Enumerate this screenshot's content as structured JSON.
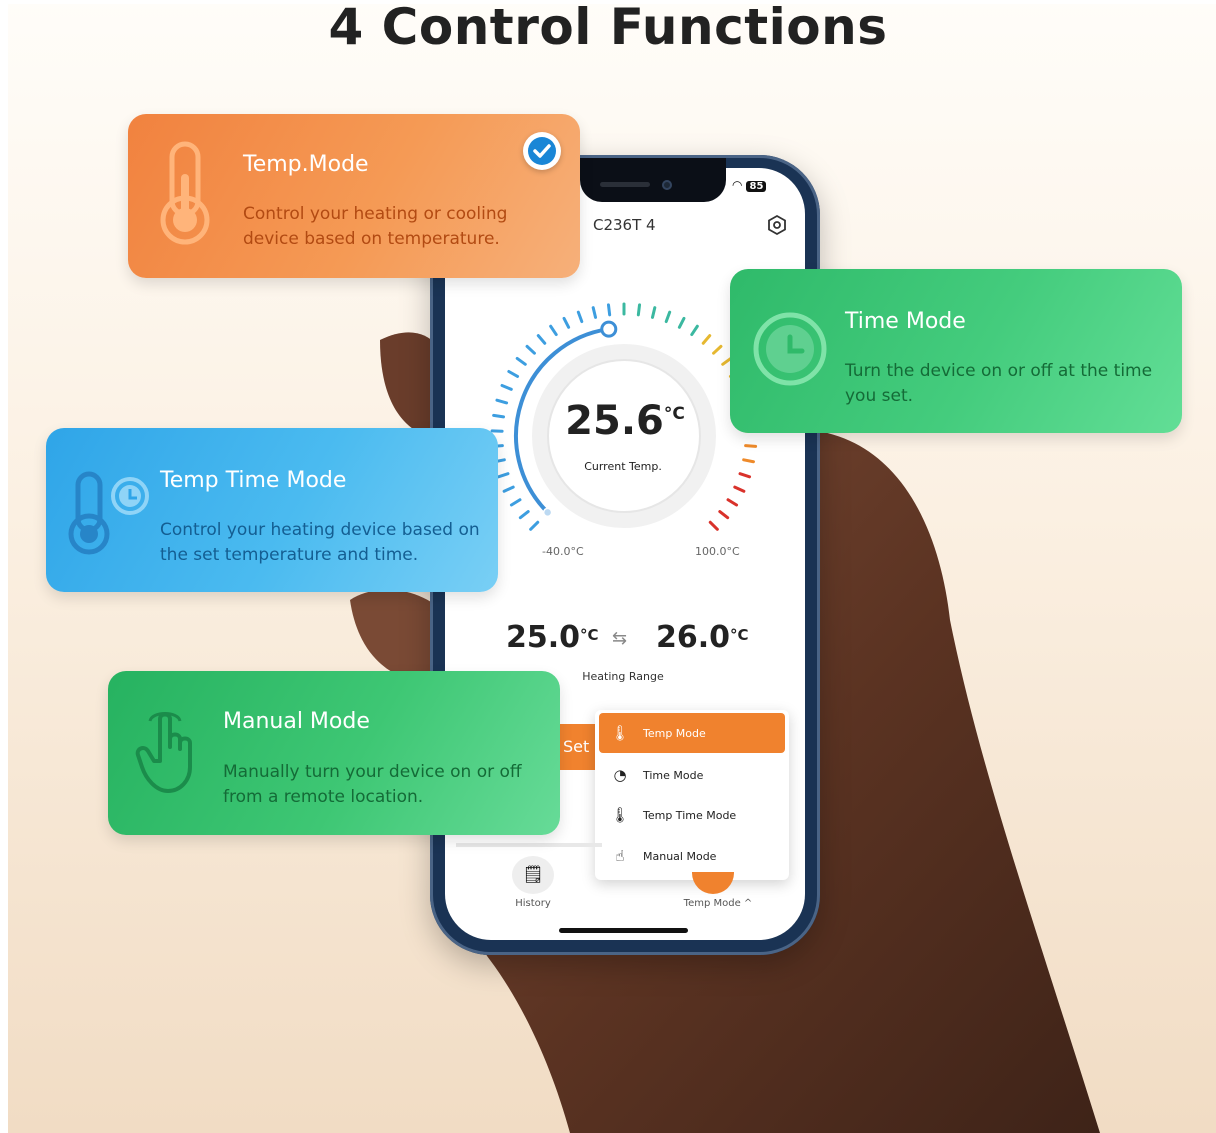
{
  "header": {
    "title": "4 Control Functions"
  },
  "phone": {
    "status_battery": "85",
    "device_name": "C236T 4",
    "current_temp": "25.6",
    "current_temp_unit": "°C",
    "current_temp_label": "Current Temp.",
    "gauge_level_fraction": 0.47,
    "scale_min": "-40.0°C",
    "scale_max": "100.0°C",
    "range_low": "25.0",
    "range_high": "26.0",
    "range_unit": "°C",
    "range_label": "Heating Range",
    "set_button": "Set",
    "menu": [
      {
        "label": "Temp Mode",
        "icon": "thermometer-icon",
        "active": true
      },
      {
        "label": "Time Mode",
        "icon": "clock-icon",
        "active": false
      },
      {
        "label": "Temp Time Mode",
        "icon": "thermometer-clock-icon",
        "active": false
      },
      {
        "label": "Manual Mode",
        "icon": "hand-pointer-icon",
        "active": false
      }
    ],
    "bottom_nav": {
      "history_label": "History",
      "mode_label": "Temp Mode ^"
    }
  },
  "cards": {
    "temp_mode": {
      "title": "Temp.Mode",
      "description": "Control your heating or cooling device based on temperature.",
      "icon": "thermometer-icon",
      "selected": true
    },
    "time_mode": {
      "title": "Time Mode",
      "description": "Turn the device on or off at the time you set.",
      "icon": "clock-icon"
    },
    "temp_time_mode": {
      "title": "Temp Time Mode",
      "description": "Control your heating device based on the set temperature and time.",
      "icon": "thermometer-clock-icon"
    },
    "manual_mode": {
      "title": "Manual Mode",
      "description": "Manually turn your device on or off from a remote location.",
      "icon": "hand-pointer-icon"
    }
  },
  "colors": {
    "temp_card": "#f1823f",
    "time_card": "#2fba6a",
    "temp_time_card": "#2fa5e8",
    "manual_card": "#26b260",
    "accent": "#f0822e",
    "check": "#1a86d6"
  }
}
